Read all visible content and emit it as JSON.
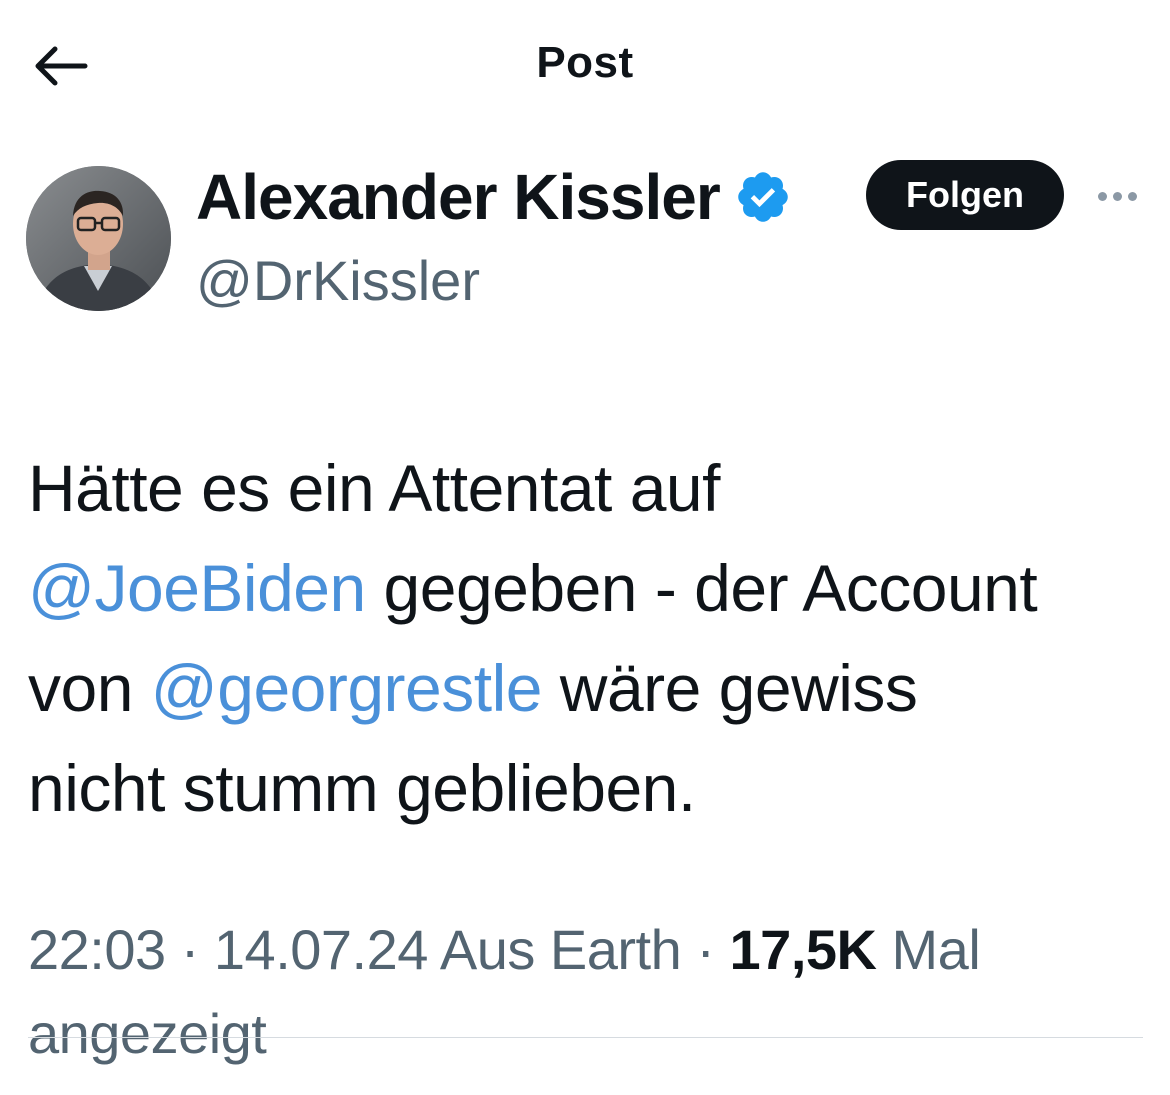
{
  "header": {
    "title": "Post",
    "back_icon": "arrow-left-icon"
  },
  "author": {
    "name": "Alexander Kissler",
    "handle": "@DrKissler",
    "verified_icon": "verified-badge-icon",
    "avatar": "avatar"
  },
  "actions": {
    "follow_label": "Folgen",
    "more_icon": "more-horizontal-icon"
  },
  "tweet": {
    "line1": "Hätte es ein Attentat auf",
    "mention1": "@JoeBiden",
    "text2": " gegeben - der Account",
    "text3": "von ",
    "mention2": "@georgrestle",
    "text4": " wäre gewiss",
    "text5": "nicht stumm geblieben."
  },
  "meta": {
    "time": "22:03",
    "separator": " · ",
    "date": "14.07.24",
    "source": " Aus Earth",
    "views_count": "17,5K",
    "views_label": " Mal angezeigt"
  },
  "colors": {
    "accent": "#1d9bf0",
    "mention": "#4a90d9",
    "text": "#0f1419",
    "secondary": "#536471",
    "button_bg": "#0f1419"
  }
}
